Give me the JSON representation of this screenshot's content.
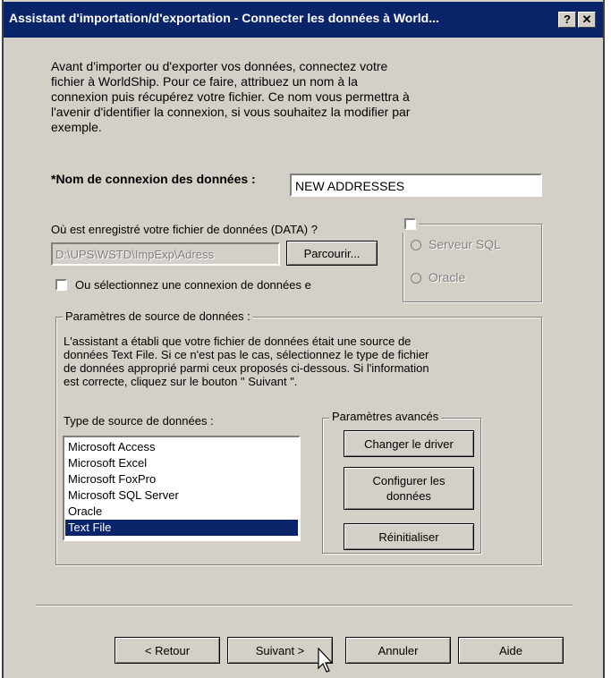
{
  "window": {
    "title": "Assistant d'importation/d'exportation - Connecter les données à World...",
    "help_btn": "?",
    "close_btn": "✕"
  },
  "intro": {
    "lines": [
      "Avant d'importer ou d'exporter vos données, connectez votre",
      "fichier à WorldShip. Pour ce faire, attribuez un nom à la",
      "connexion puis récupérez votre fichier. Ce nom vous permettra à",
      "l'avenir d'identifier la connexion, si vous souhaitez la modifier par",
      "exemple."
    ]
  },
  "connection": {
    "label": "*Nom de connexion des données :",
    "value": "NEW ADDRESSES"
  },
  "file": {
    "label": "Où est enregistré votre fichier de données (DATA) ?",
    "path": "D:\\UPS\\WSTD\\ImpExp\\Adress",
    "browse": "Parcourir...",
    "select_existing": "Ou sélectionnez une connexion de données e"
  },
  "db_group": {
    "sql_server": "Serveur SQL",
    "oracle": "Oracle"
  },
  "source_params": {
    "legend": "Paramètres de source de données :",
    "description": [
      "L'assistant a établi que votre fichier de données était une source de",
      "données Text File. Si ce n'est pas le cas, sélectionnez le type de fichier",
      "de données approprié parmi ceux proposés ci-dessous. Si l'information",
      "est correcte, cliquez sur le bouton \" Suivant \"."
    ],
    "type_label": "Type de source de données :",
    "types": [
      "Microsoft Access",
      "Microsoft Excel",
      "Microsoft FoxPro",
      "Microsoft SQL Server",
      "Oracle",
      "Text File"
    ],
    "selected_type": "Text File"
  },
  "advanced": {
    "legend": "Paramètres avancés",
    "change_driver": "Changer le driver",
    "configure_line1": "Configurer les",
    "configure_line2": "données",
    "reset": "Réinitialiser"
  },
  "footer": {
    "back": "< Retour",
    "next": "Suivant >",
    "cancel": "Annuler",
    "help": "Aide"
  }
}
